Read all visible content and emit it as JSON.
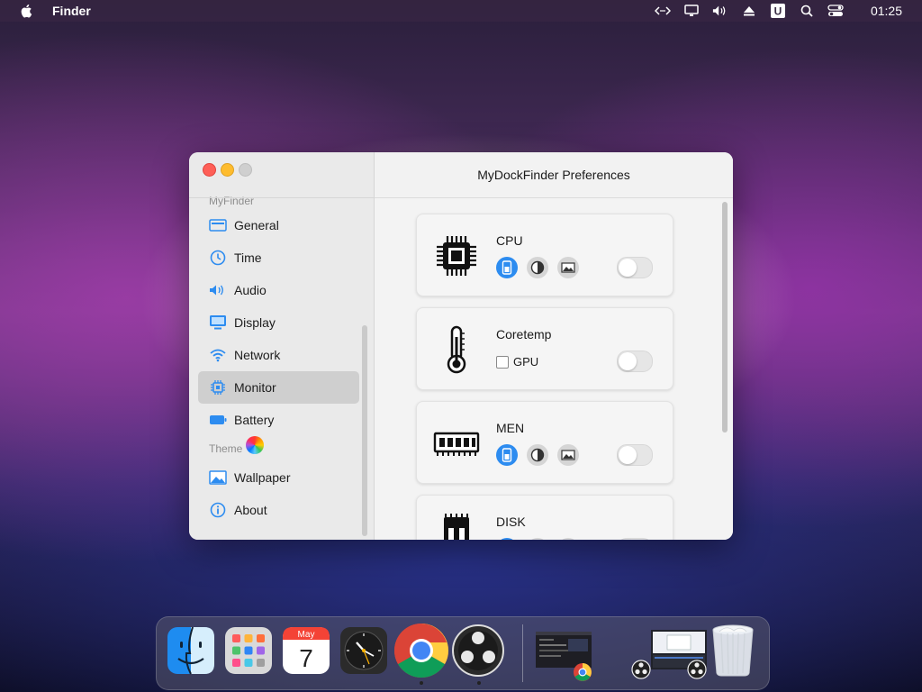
{
  "menubar": {
    "app_name": "Finder",
    "clock": "01:25",
    "icons": [
      "apple-icon",
      "code-icon",
      "display-icon",
      "volume-icon",
      "eject-icon",
      "u-icon",
      "search-icon",
      "control-center-icon"
    ]
  },
  "window": {
    "title": "MyDockFinder Preferences",
    "sidebar": {
      "section_label": "MyFinder",
      "items": [
        {
          "label": "General",
          "icon": "general-icon"
        },
        {
          "label": "Time",
          "icon": "clock-icon"
        },
        {
          "label": "Audio",
          "icon": "audio-icon"
        },
        {
          "label": "Display",
          "icon": "display-icon"
        },
        {
          "label": "Network",
          "icon": "wifi-icon"
        },
        {
          "label": "Monitor",
          "icon": "chip-icon",
          "selected": true
        },
        {
          "label": "Battery",
          "icon": "battery-icon"
        }
      ],
      "theme_label": "Theme",
      "theme_items": [
        {
          "label": "Wallpaper",
          "icon": "wallpaper-icon"
        },
        {
          "label": "About",
          "icon": "info-icon"
        }
      ]
    },
    "cards": [
      {
        "title": "CPU",
        "icon": "cpu-icon",
        "type": "modes",
        "active_mode": 0,
        "enabled": false
      },
      {
        "title": "Coretemp",
        "icon": "thermometer-icon",
        "type": "checkbox",
        "checkbox_label": "GPU",
        "checked": false,
        "enabled": false
      },
      {
        "title": "MEN",
        "icon": "memory-icon",
        "type": "modes",
        "active_mode": 0,
        "enabled": false
      },
      {
        "title": "DISK",
        "icon": "disk-icon",
        "type": "modes",
        "active_mode": 0,
        "enabled": false
      }
    ]
  },
  "dock": {
    "calendar_month": "May",
    "calendar_day": "7",
    "apps": [
      "finder-icon",
      "launchpad-icon",
      "calendar-icon",
      "clock-icon",
      "chrome-icon",
      "obs-icon"
    ],
    "running": [
      "chrome-icon",
      "obs-icon"
    ],
    "windows": [
      "chrome-window-thumbnail",
      "obs-window-thumbnail"
    ],
    "trash": "trash-icon"
  },
  "colors": {
    "accent": "#2d8cf0",
    "selected_bg": "#cfcfcf",
    "close": "#fe5f57",
    "minimize": "#febc2e",
    "maximize": "#cfcfcf"
  }
}
